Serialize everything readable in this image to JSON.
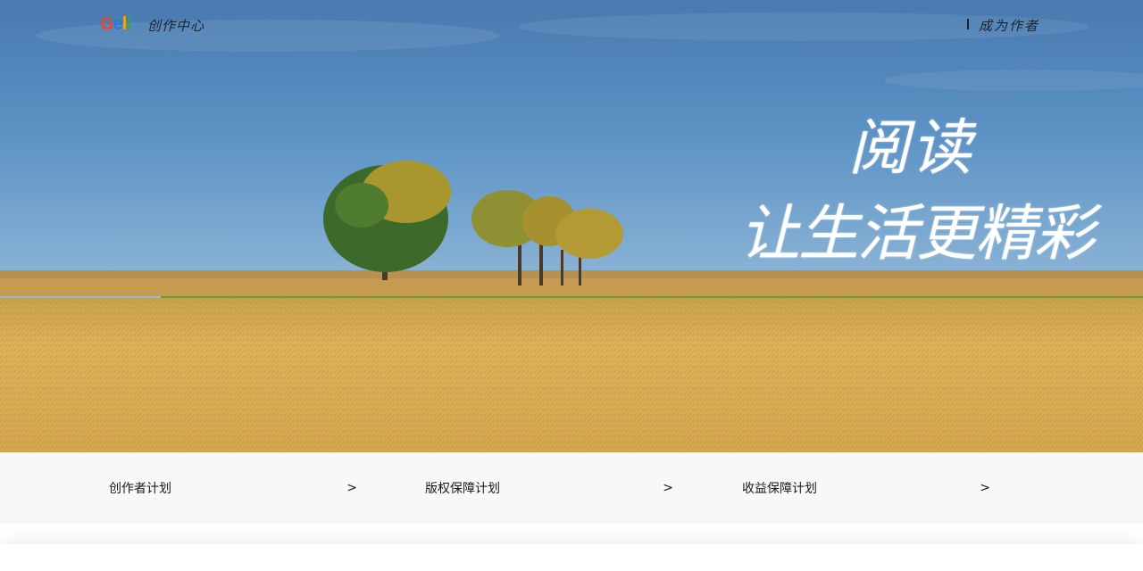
{
  "header": {
    "logo_parts": [
      "G",
      "e",
      "l",
      "i"
    ],
    "subtitle": "创作中心",
    "become_author": "成为作者"
  },
  "hero": {
    "slogan_line1": "阅读",
    "slogan_line2": "让生活更精彩",
    "colors": {
      "sky": "#5a91c3",
      "field": "#d8ae55",
      "grass": "#6d9a3c",
      "text": "#ffffff"
    }
  },
  "plans": [
    {
      "label": "创作者计划",
      "arrow": ">"
    },
    {
      "label": "版权保障计划",
      "arrow": ">"
    },
    {
      "label": "收益保障计划",
      "arrow": ">"
    }
  ],
  "colors": {
    "strip_bg": "#f7f8fa",
    "text": "#1a1a1a"
  }
}
